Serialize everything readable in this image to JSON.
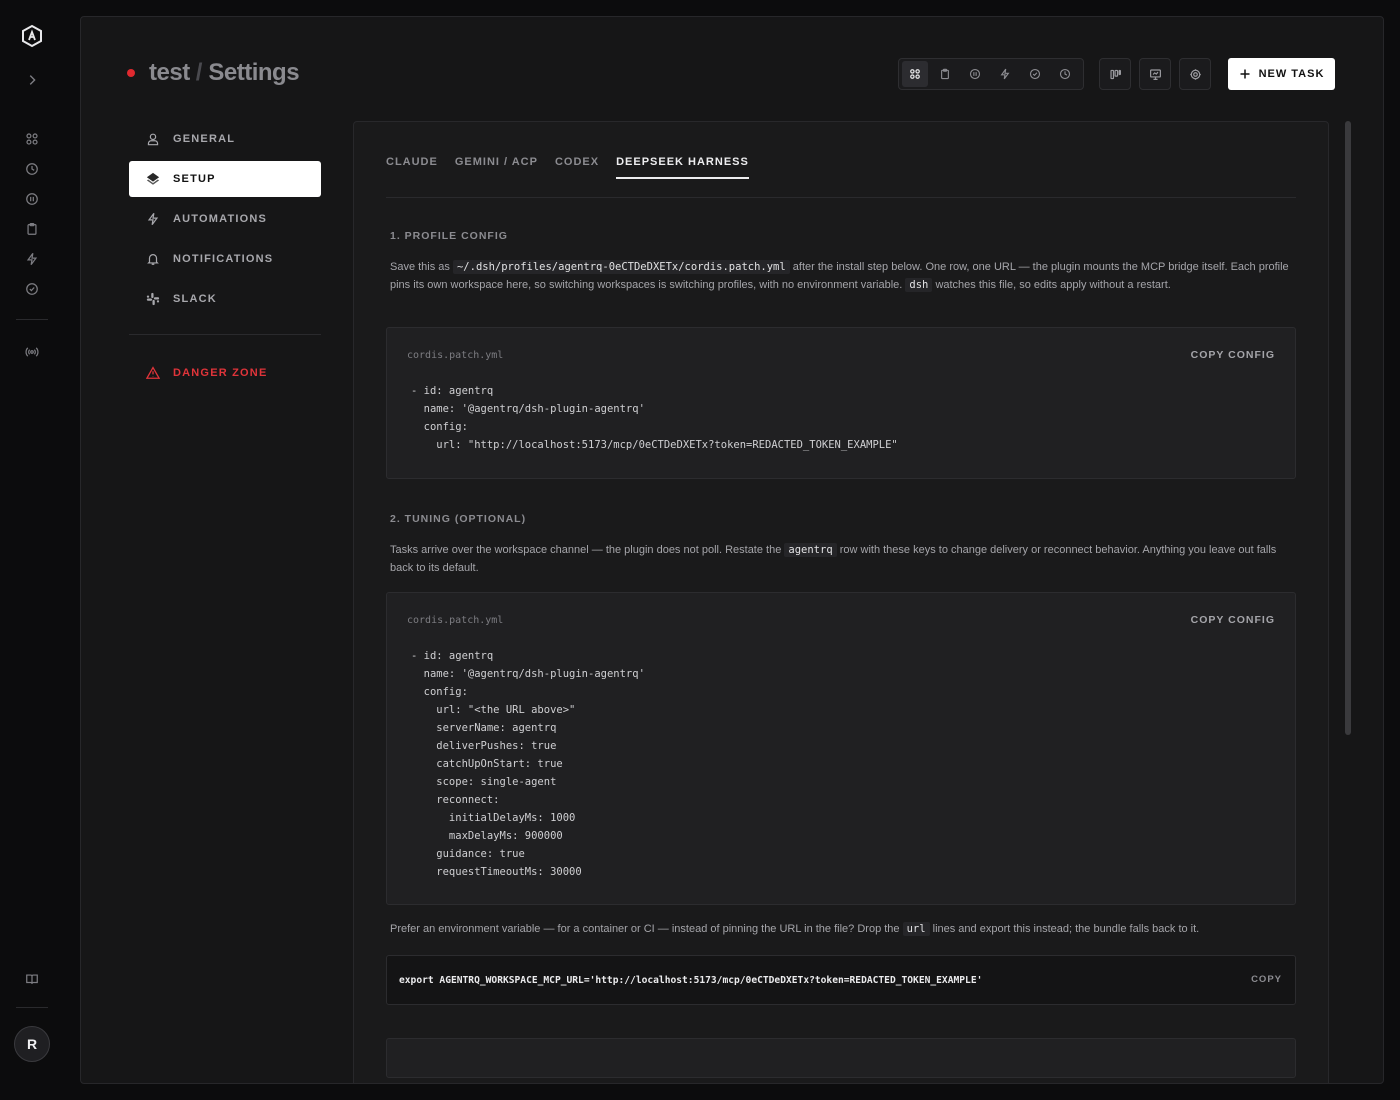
{
  "rail": {
    "avatar_initial": "R"
  },
  "header": {
    "project": "test",
    "separator": "/",
    "page": "Settings",
    "new_task_label": "NEW TASK"
  },
  "settings_nav": {
    "items": [
      {
        "label": "GENERAL"
      },
      {
        "label": "SETUP"
      },
      {
        "label": "AUTOMATIONS"
      },
      {
        "label": "NOTIFICATIONS"
      },
      {
        "label": "SLACK"
      }
    ],
    "danger_label": "DANGER ZONE"
  },
  "tabs": [
    "CLAUDE",
    "GEMINI / ACP",
    "CODEX",
    "DEEPSEEK HARNESS"
  ],
  "section1": {
    "heading": "1. PROFILE CONFIG",
    "p1_a": "Save this as",
    "p1_code1": "~/.dsh/profiles/agentrq-0eCTDeDXETx/cordis.patch.yml",
    "p1_b": "after the install step below. One row, one URL — the plugin mounts the MCP bridge itself. Each profile pins its own workspace here, so switching workspaces is switching profiles, with no environment variable.",
    "p1_code2": "dsh",
    "p1_c": "watches this file, so edits apply without a restart.",
    "file": "cordis.patch.yml",
    "copy_label": "COPY CONFIG",
    "code": "- id: agentrq\n  name: '@agentrq/dsh-plugin-agentrq'\n  config:\n    url: \"http://localhost:5173/mcp/0eCTDeDXETx?token=REDACTED_TOKEN_EXAMPLE\""
  },
  "section2": {
    "heading": "2. TUNING (OPTIONAL)",
    "p_a": "Tasks arrive over the workspace channel — the plugin does not poll. Restate the",
    "p_code": "agentrq",
    "p_b": "row with these keys to change delivery or reconnect behavior. Anything you leave out falls back to its default.",
    "file": "cordis.patch.yml",
    "copy_label": "COPY CONFIG",
    "code": "- id: agentrq\n  name: '@agentrq/dsh-plugin-agentrq'\n  config:\n    url: \"<the URL above>\"\n    serverName: agentrq\n    deliverPushes: true\n    catchUpOnStart: true\n    scope: single-agent\n    reconnect:\n      initialDelayMs: 1000\n      maxDelayMs: 900000\n    guidance: true\n    requestTimeoutMs: 30000"
  },
  "env": {
    "p_a": "Prefer an environment variable — for a container or CI — instead of pinning the URL in the file? Drop the",
    "p_code": "url",
    "p_b": "lines and export this instead; the bundle falls back to it.",
    "export_line": "export AGENTRQ_WORKSPACE_MCP_URL='http://localhost:5173/mcp/0eCTDeDXETx?token=REDACTED_TOKEN_EXAMPLE'",
    "copy_label": "COPY"
  },
  "colors": {
    "status_dot": "#e0292f",
    "danger": "#e0343a",
    "background": "#0c0c0d",
    "panel": "#1a1a1b"
  },
  "icons": {
    "rail": [
      "app-logo-icon",
      "chevron-right-icon",
      "grid-icon",
      "clock-icon",
      "pause-icon",
      "clipboard-icon",
      "bolt-icon",
      "check-circle-icon",
      "broadcast-icon",
      "book-icon"
    ],
    "toolbar": [
      "grid-icon",
      "clipboard-icon",
      "pause-icon",
      "bolt-icon",
      "check-circle-icon",
      "clock-icon",
      "columns-icon",
      "presentation-icon",
      "settings-icon",
      "plus-icon"
    ],
    "nav": [
      "user-icon",
      "layers-icon",
      "bolt-icon",
      "bell-icon",
      "slack-icon",
      "warning-icon"
    ]
  }
}
